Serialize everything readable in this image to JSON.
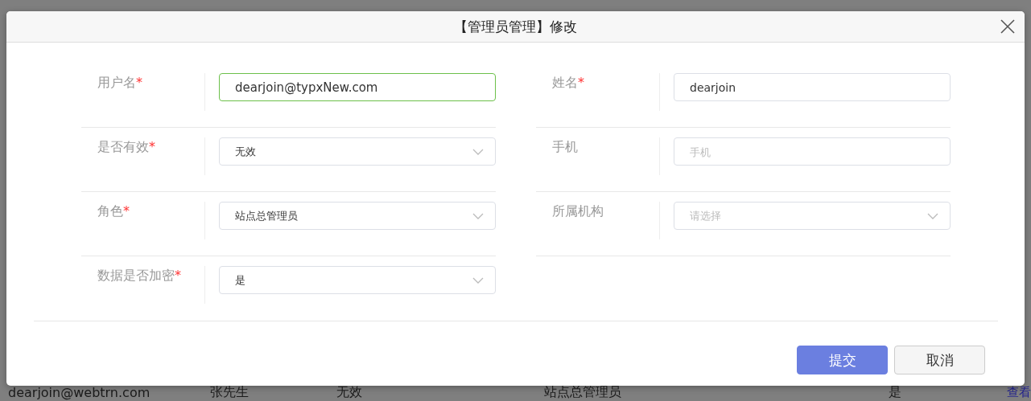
{
  "background_row": [
    {
      "text": "dearjoin@webtrn.com",
      "kind": "text"
    },
    {
      "text": "张先生",
      "kind": "text"
    },
    {
      "text": "无效",
      "kind": "text"
    },
    {
      "text": "站点总管理员",
      "kind": "text"
    },
    {
      "text": "是",
      "kind": "text"
    },
    {
      "text": "查看",
      "kind": "link"
    }
  ],
  "dialog": {
    "title": "【管理员管理】修改",
    "columns": [
      [
        {
          "label": "用户名",
          "required_mark": "*",
          "kind": "text",
          "value": "dearjoin@typxNew.com",
          "focused": true
        },
        {
          "label": "是否有效",
          "required_mark": "*",
          "kind": "select",
          "value": "无效",
          "focused": false
        },
        {
          "label": "角色",
          "required_mark": "*",
          "kind": "select",
          "value": "站点总管理员",
          "focused": false
        },
        {
          "label": "数据是否加密",
          "required_mark": "*",
          "kind": "select",
          "value": "是",
          "focused": false
        }
      ],
      [
        {
          "label": "姓名",
          "required_mark": "*",
          "kind": "text",
          "value": "dearjoin",
          "focused": false
        },
        {
          "label": "手机",
          "kind": "text",
          "placeholder": "手机",
          "focused": false
        },
        {
          "label": "所属机构",
          "kind": "select",
          "placeholder": "请选择",
          "focused": false
        }
      ]
    ],
    "buttons": [
      {
        "label": "提交",
        "kind": "primary"
      },
      {
        "label": "取消",
        "kind": "default"
      }
    ]
  }
}
